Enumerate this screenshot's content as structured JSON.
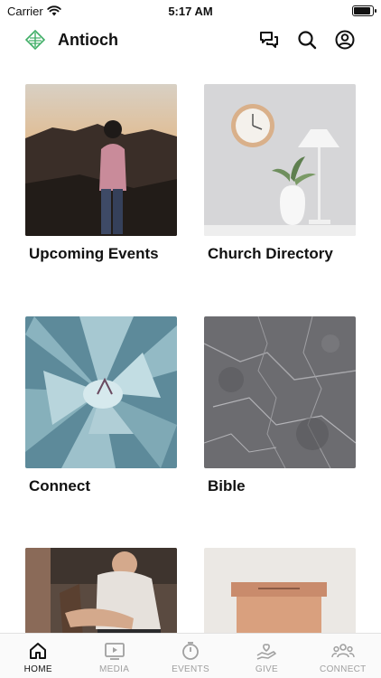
{
  "status_bar": {
    "carrier": "Carrier",
    "time": "5:17 AM",
    "battery_level": 0.9
  },
  "header": {
    "title": "Antioch",
    "brand_color": "#3fae66"
  },
  "tiles": [
    {
      "label": "Upcoming Events"
    },
    {
      "label": "Church Directory"
    },
    {
      "label": "Connect"
    },
    {
      "label": "Bible"
    },
    {
      "label": ""
    },
    {
      "label": ""
    }
  ],
  "tab_bar": {
    "active_index": 0,
    "items": [
      {
        "label": "HOME",
        "icon": "home-icon"
      },
      {
        "label": "MEDIA",
        "icon": "media-icon"
      },
      {
        "label": "EVENTS",
        "icon": "stopwatch-icon"
      },
      {
        "label": "GIVE",
        "icon": "give-hand-icon"
      },
      {
        "label": "CONNECT",
        "icon": "group-icon"
      }
    ]
  }
}
